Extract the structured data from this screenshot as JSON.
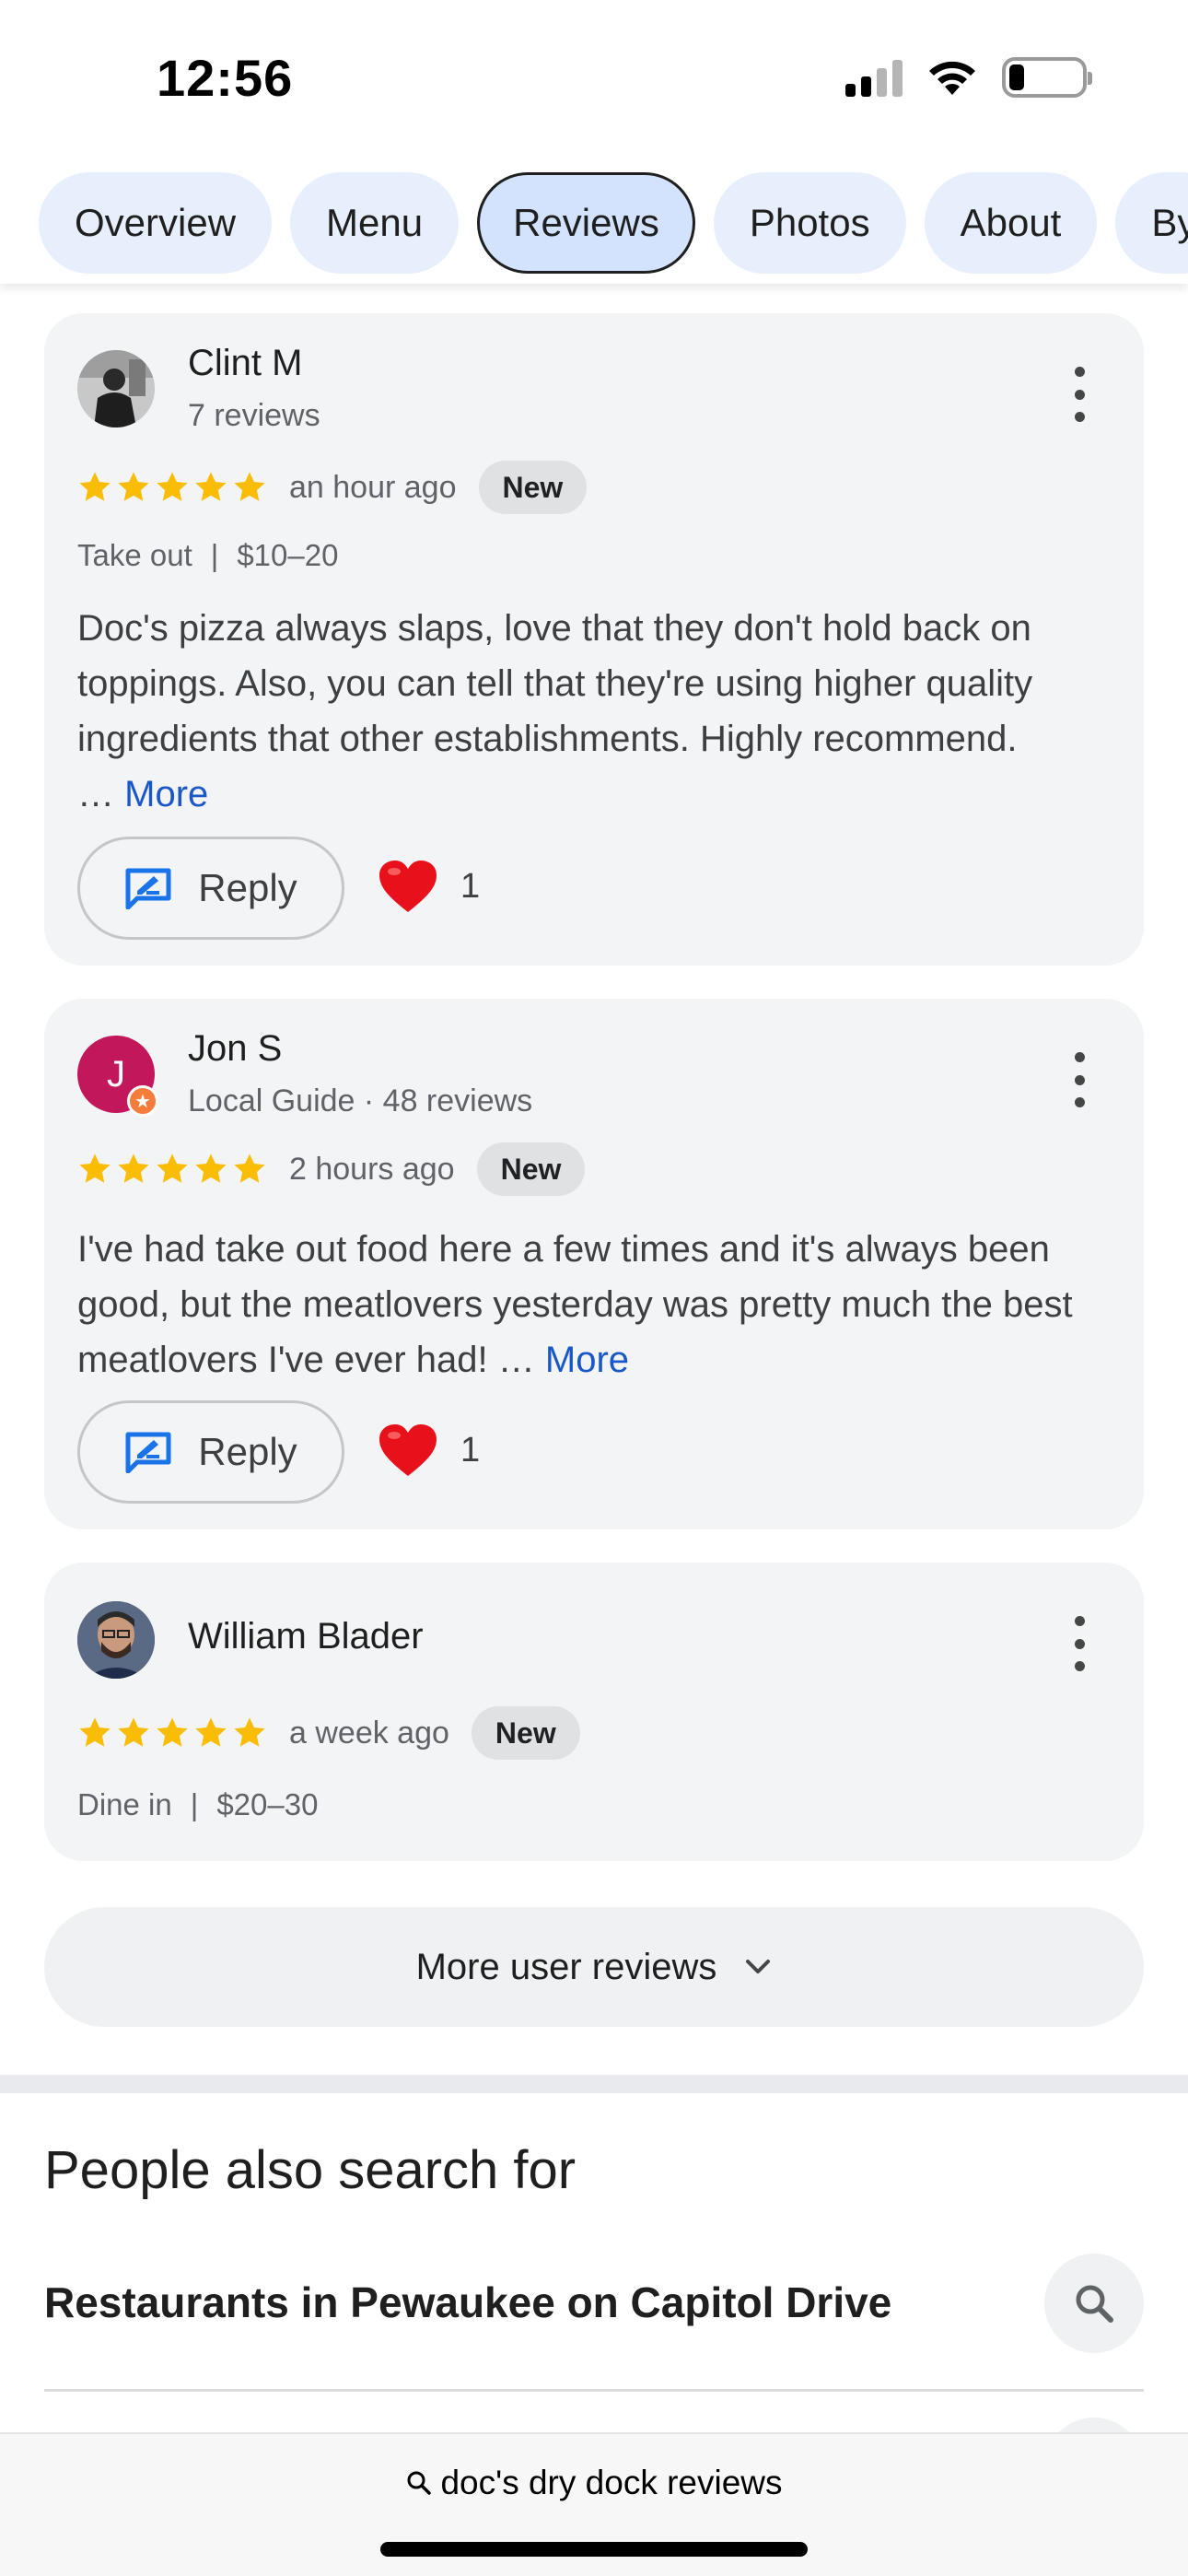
{
  "status_bar": {
    "time": "12:56"
  },
  "tabs": [
    {
      "label": "Overview"
    },
    {
      "label": "Menu"
    },
    {
      "label": "Reviews"
    },
    {
      "label": "Photos"
    },
    {
      "label": "About"
    },
    {
      "label": "By"
    }
  ],
  "active_tab": "Reviews",
  "reviews": [
    {
      "name": "Clint M",
      "meta": "7 reviews",
      "stars": 5,
      "time_ago": "an hour ago",
      "badge": "New",
      "service": "Take out",
      "price": "$10–20",
      "text": "Doc's pizza always slaps, love that they don't hold back on toppings. Also, you can tell that they're using higher quality ingredients that other establishments. Highly recommend.",
      "ellipsis": "…",
      "more": "More",
      "reply_label": "Reply",
      "likes": "1"
    },
    {
      "name": "Jon S",
      "meta": "Local Guide · 48 reviews",
      "avatar_letter": "J",
      "stars": 5,
      "time_ago": "2 hours ago",
      "badge": "New",
      "text": "I've had take out food here a few times and it's always been good, but the meatlovers yesterday was pretty much the best meatlovers I've ever had!",
      "ellipsis": "…",
      "more": "More",
      "reply_label": "Reply",
      "likes": "1"
    },
    {
      "name": "William Blader",
      "stars": 5,
      "time_ago": "a week ago",
      "badge": "New",
      "service": "Dine in",
      "price": "$20–30"
    }
  ],
  "more_reviews_label": "More user reviews",
  "people_also_search": {
    "title": "People also search for",
    "items": [
      {
        "label": "Restaurants in Pewaukee on Capitol Drive"
      }
    ]
  },
  "bottom_bar": {
    "query": "doc's dry dock reviews"
  },
  "colors": {
    "star": "#fbbc04",
    "link": "#1a57c7",
    "active_tab_bg": "#d3e3fd",
    "tab_bg": "#e8effc",
    "card_bg": "#f3f4f6",
    "reply_icon": "#1a73e8",
    "heart": "#e8111b",
    "jon_avatar": "#c2185b",
    "guide_badge": "#f57c3a"
  },
  "icons": {
    "reply": "reply-edit-icon",
    "heart": "heart-icon",
    "more": "more-vert-icon",
    "search": "search-icon",
    "expand": "chevron-down-icon"
  }
}
